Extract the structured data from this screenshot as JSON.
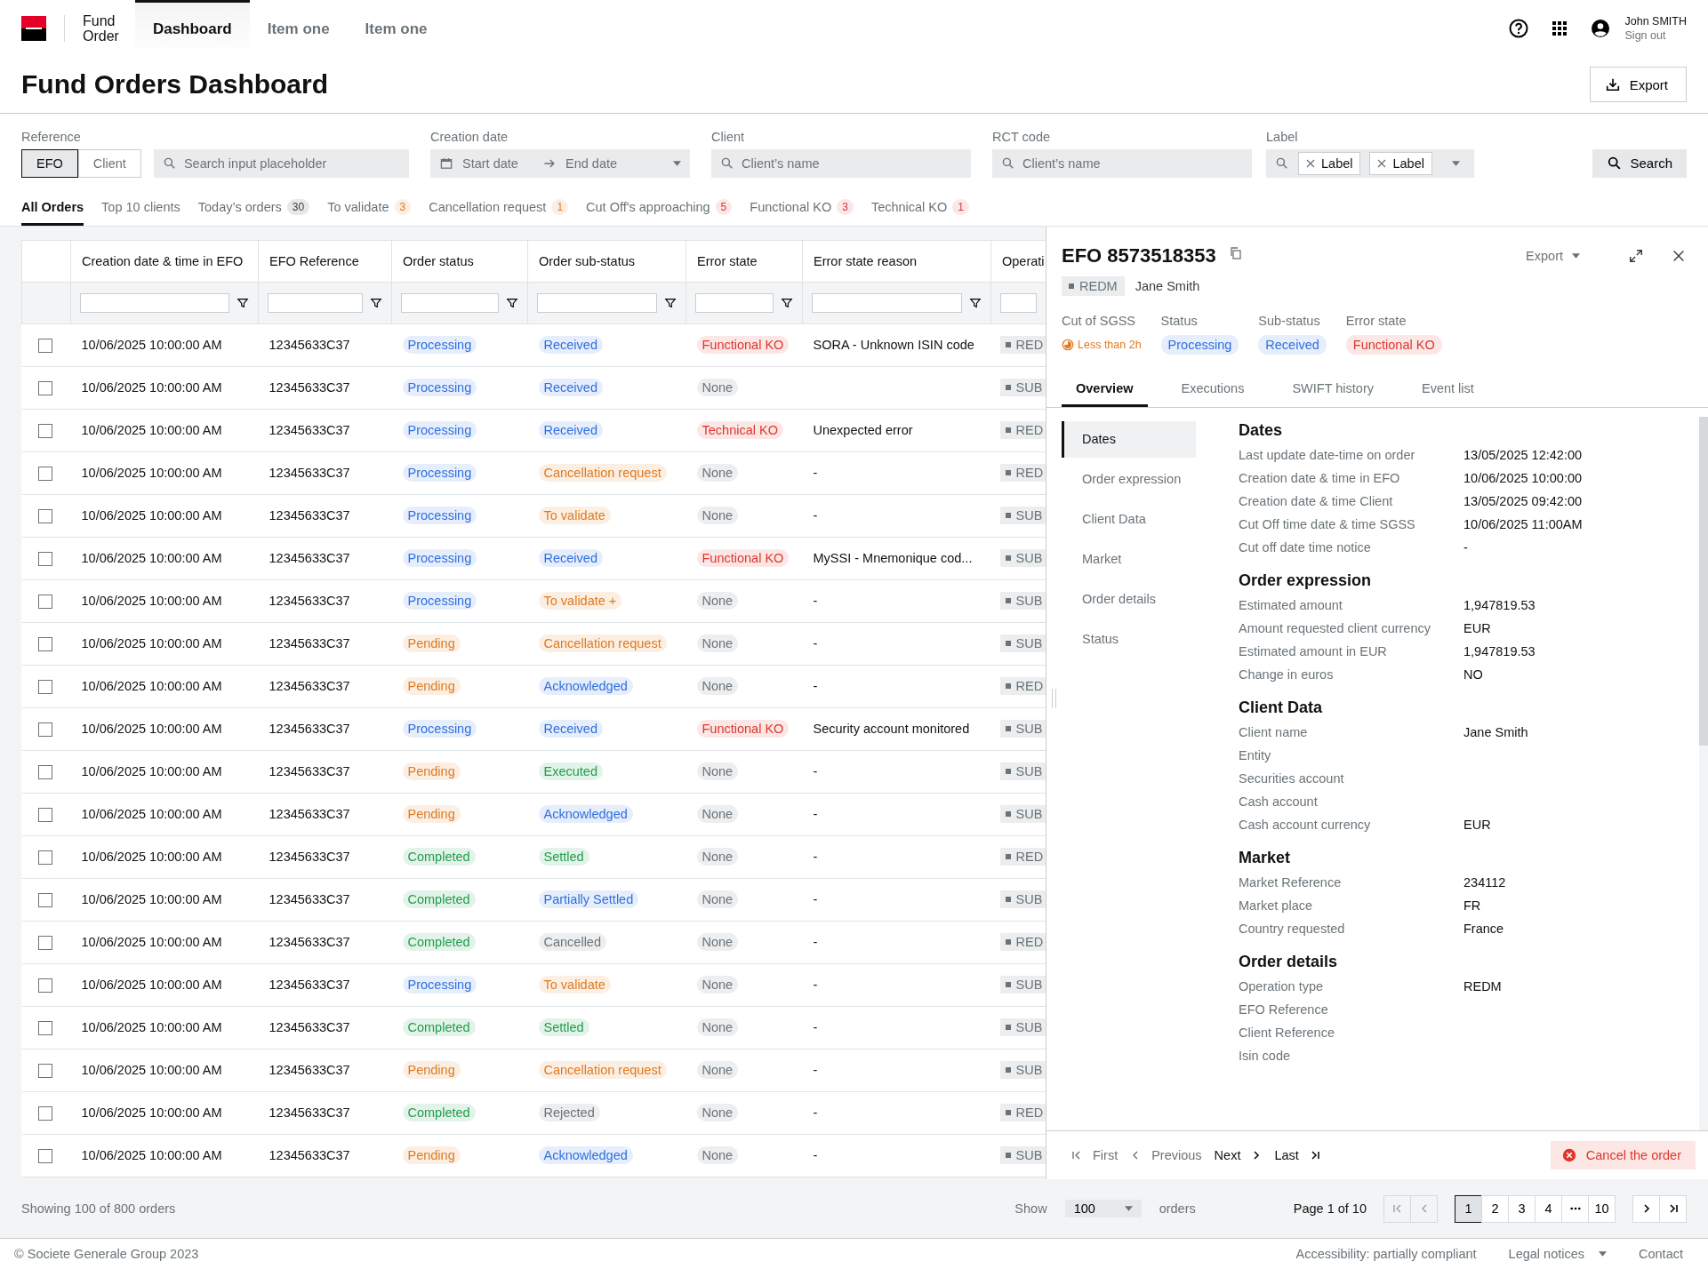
{
  "header": {
    "app_name_lines": [
      "Fund",
      "Order"
    ],
    "nav": [
      {
        "label": "Dashboard",
        "selected": true
      },
      {
        "label": "Item one",
        "selected": false
      },
      {
        "label": "Item one",
        "selected": false
      }
    ],
    "user": {
      "name": "John SMITH",
      "action": "Sign out"
    }
  },
  "page_title": "Fund Orders Dashboard",
  "export_button": "Export",
  "filters": {
    "reference": {
      "label": "Reference",
      "options": [
        {
          "label": "EFO",
          "selected": true
        },
        {
          "label": "Client",
          "selected": false
        }
      ],
      "placeholder": "Search input placeholder"
    },
    "creation_date": {
      "label": "Creation date",
      "start_placeholder": "Start date",
      "end_placeholder": "End date"
    },
    "client": {
      "label": "Client",
      "placeholder": "Client’s name"
    },
    "rct_code": {
      "label": "RCT code",
      "placeholder": "Client’s name"
    },
    "label": {
      "label": "Label",
      "tags": [
        "Label",
        "Label"
      ]
    },
    "search_button": "Search"
  },
  "order_tabs": [
    {
      "label": "All Orders",
      "selected": true
    },
    {
      "label": "Top 10 clients",
      "selected": false
    },
    {
      "label": "Today’s orders",
      "count": "30",
      "color": "#3a3f42",
      "selected": false
    },
    {
      "label": "To validate",
      "count": "3",
      "color": "#e07a1f",
      "selected": false
    },
    {
      "label": "Cancellation request",
      "count": "1",
      "color": "#e07a1f",
      "selected": false
    },
    {
      "label": "Cut Off's approaching",
      "count": "5",
      "color": "#e0352b",
      "selected": false
    },
    {
      "label": "Functional KO",
      "count": "3",
      "color": "#e0352b",
      "selected": false
    },
    {
      "label": "Technical KO",
      "count": "1",
      "color": "#e0352b",
      "selected": false
    }
  ],
  "table": {
    "columns": [
      "Creation date & time in EFO",
      "EFO Reference",
      "Order status",
      "Order sub-status",
      "Error state",
      "Error state reason",
      "Operati"
    ],
    "rows": [
      {
        "checked": false,
        "date": "10/06/2025 10:00:00 AM",
        "ref": "12345633C37",
        "status": {
          "text": "Processing",
          "color": "#2f6fe0"
        },
        "sub": {
          "text": "Received",
          "color": "#2f6fe0"
        },
        "error": {
          "text": "Functional KO",
          "color": "#e0352b"
        },
        "reason": "SORA - Unknown ISIN code",
        "op": "RED"
      },
      {
        "checked": false,
        "date": "10/06/2025 10:00:00 AM",
        "ref": "12345633C37",
        "status": {
          "text": "Processing",
          "color": "#2f6fe0"
        },
        "sub": {
          "text": "Received",
          "color": "#2f6fe0"
        },
        "error": {
          "text": "None",
          "color": "#6b7378"
        },
        "op": "SUB"
      },
      {
        "checked": false,
        "date": "10/06/2025 10:00:00 AM",
        "ref": "12345633C37",
        "status": {
          "text": "Processing",
          "color": "#2f6fe0"
        },
        "sub": {
          "text": "Received",
          "color": "#2f6fe0"
        },
        "error": {
          "text": "Technical KO",
          "color": "#e0352b"
        },
        "reason": "Unexpected error",
        "op": "RED"
      },
      {
        "checked": false,
        "date": "10/06/2025 10:00:00 AM",
        "ref": "12345633C37",
        "status": {
          "text": "Processing",
          "color": "#2f6fe0"
        },
        "sub": {
          "text": "Cancellation request",
          "color": "#e07a1f"
        },
        "error": {
          "text": "None",
          "color": "#6b7378"
        },
        "reason": "-",
        "op": "RED"
      },
      {
        "checked": false,
        "date": "10/06/2025 10:00:00 AM",
        "ref": "12345633C37",
        "status": {
          "text": "Processing",
          "color": "#2f6fe0"
        },
        "sub": {
          "text": "To validate",
          "color": "#e07a1f"
        },
        "error": {
          "text": "None",
          "color": "#6b7378"
        },
        "reason": "-",
        "op": "SUB"
      },
      {
        "checked": false,
        "date": "10/06/2025 10:00:00 AM",
        "ref": "12345633C37",
        "status": {
          "text": "Processing",
          "color": "#2f6fe0"
        },
        "sub": {
          "text": "Received",
          "color": "#2f6fe0"
        },
        "error": {
          "text": "Functional KO",
          "color": "#e0352b"
        },
        "reason": "MySSI - Mnemonique cod...",
        "op": "SUB"
      },
      {
        "checked": false,
        "date": "10/06/2025 10:00:00 AM",
        "ref": "12345633C37",
        "status": {
          "text": "Processing",
          "color": "#2f6fe0"
        },
        "sub": {
          "text": "To validate +",
          "color": "#e07a1f"
        },
        "error": {
          "text": "None",
          "color": "#6b7378"
        },
        "reason": "-",
        "op": "SUB"
      },
      {
        "checked": false,
        "date": "10/06/2025 10:00:00 AM",
        "ref": "12345633C37",
        "status": {
          "text": "Pending",
          "color": "#e07a1f"
        },
        "sub": {
          "text": "Cancellation request",
          "color": "#e07a1f"
        },
        "error": {
          "text": "None",
          "color": "#6b7378"
        },
        "reason": "-",
        "op": "SUB"
      },
      {
        "checked": false,
        "date": "10/06/2025 10:00:00 AM",
        "ref": "12345633C37",
        "status": {
          "text": "Pending",
          "color": "#e07a1f"
        },
        "sub": {
          "text": "Acknowledged",
          "color": "#2f6fe0"
        },
        "error": {
          "text": "None",
          "color": "#6b7378"
        },
        "reason": "-",
        "op": "RED"
      },
      {
        "checked": false,
        "date": "10/06/2025 10:00:00 AM",
        "ref": "12345633C37",
        "status": {
          "text": "Processing",
          "color": "#2f6fe0"
        },
        "sub": {
          "text": "Received",
          "color": "#2f6fe0"
        },
        "error": {
          "text": "Functional KO",
          "color": "#e0352b"
        },
        "reason": "Security account monitored",
        "op": "SUB"
      },
      {
        "checked": false,
        "date": "10/06/2025 10:00:00 AM",
        "ref": "12345633C37",
        "status": {
          "text": "Pending",
          "color": "#e07a1f"
        },
        "sub": {
          "text": "Executed",
          "color": "#1e9e4a"
        },
        "error": {
          "text": "None",
          "color": "#6b7378"
        },
        "reason": "-",
        "op": "SUB"
      },
      {
        "checked": false,
        "date": "10/06/2025 10:00:00 AM",
        "ref": "12345633C37",
        "status": {
          "text": "Pending",
          "color": "#e07a1f"
        },
        "sub": {
          "text": "Acknowledged",
          "color": "#2f6fe0"
        },
        "error": {
          "text": "None",
          "color": "#6b7378"
        },
        "reason": "-",
        "op": "SUB"
      },
      {
        "checked": false,
        "date": "10/06/2025 10:00:00 AM",
        "ref": "12345633C37",
        "status": {
          "text": "Completed",
          "color": "#1e9e4a"
        },
        "sub": {
          "text": "Settled",
          "color": "#1e9e4a"
        },
        "error": {
          "text": "None",
          "color": "#6b7378"
        },
        "reason": "-",
        "op": "RED"
      },
      {
        "checked": false,
        "date": "10/06/2025 10:00:00 AM",
        "ref": "12345633C37",
        "status": {
          "text": "Completed",
          "color": "#1e9e4a"
        },
        "sub": {
          "text": "Partially Settled",
          "color": "#2f6fe0"
        },
        "error": {
          "text": "None",
          "color": "#6b7378"
        },
        "reason": "-",
        "op": "SUB"
      },
      {
        "checked": false,
        "date": "10/06/2025 10:00:00 AM",
        "ref": "12345633C37",
        "status": {
          "text": "Completed",
          "color": "#1e9e4a"
        },
        "sub": {
          "text": "Cancelled",
          "color": "#6b7378"
        },
        "error": {
          "text": "None",
          "color": "#6b7378"
        },
        "reason": "-",
        "op": "RED"
      },
      {
        "checked": false,
        "date": "10/06/2025 10:00:00 AM",
        "ref": "12345633C37",
        "status": {
          "text": "Processing",
          "color": "#2f6fe0"
        },
        "sub": {
          "text": "To validate",
          "color": "#e07a1f"
        },
        "error": {
          "text": "None",
          "color": "#6b7378"
        },
        "reason": "-",
        "op": "SUB"
      },
      {
        "checked": false,
        "date": "10/06/2025 10:00:00 AM",
        "ref": "12345633C37",
        "status": {
          "text": "Completed",
          "color": "#1e9e4a"
        },
        "sub": {
          "text": "Settled",
          "color": "#1e9e4a"
        },
        "error": {
          "text": "None",
          "color": "#6b7378"
        },
        "reason": "-",
        "op": "SUB"
      },
      {
        "checked": false,
        "date": "10/06/2025 10:00:00 AM",
        "ref": "12345633C37",
        "status": {
          "text": "Pending",
          "color": "#e07a1f"
        },
        "sub": {
          "text": "Cancellation request",
          "color": "#e07a1f"
        },
        "error": {
          "text": "None",
          "color": "#6b7378"
        },
        "reason": "-",
        "op": "SUB"
      },
      {
        "checked": false,
        "date": "10/06/2025 10:00:00 AM",
        "ref": "12345633C37",
        "status": {
          "text": "Completed",
          "color": "#1e9e4a"
        },
        "sub": {
          "text": "Rejected",
          "color": "#6b7378"
        },
        "error": {
          "text": "None",
          "color": "#6b7378"
        },
        "reason": "-",
        "op": "RED"
      },
      {
        "checked": false,
        "date": "10/06/2025 10:00:00 AM",
        "ref": "12345633C37",
        "status": {
          "text": "Pending",
          "color": "#e07a1f"
        },
        "sub": {
          "text": "Acknowledged",
          "color": "#2f6fe0"
        },
        "error": {
          "text": "None",
          "color": "#6b7378"
        },
        "reason": "-",
        "op": "SUB"
      }
    ]
  },
  "detail": {
    "title": "EFO 8573518353",
    "export": "Export",
    "operation": "REDM",
    "client": "Jane Smith",
    "summary": [
      {
        "kind": "deadline",
        "label": "Cut of SGSS",
        "text": "Less than 2h"
      },
      {
        "kind": "chip",
        "label": "Status",
        "text": "Processing",
        "color": "#2f6fe0"
      },
      {
        "kind": "chip",
        "label": "Sub-status",
        "text": "Received",
        "color": "#2f6fe0"
      },
      {
        "kind": "chip",
        "label": "Error state",
        "text": "Functional KO",
        "color": "#e0352b"
      }
    ],
    "tabs": [
      {
        "label": "Overview",
        "selected": true
      },
      {
        "label": "Executions",
        "selected": false
      },
      {
        "label": "SWIFT history",
        "selected": false
      },
      {
        "label": "Event list",
        "selected": false
      }
    ],
    "side_nav": [
      {
        "label": "Dates",
        "selected": true
      },
      {
        "label": "Order expression",
        "selected": false
      },
      {
        "label": "Client Data",
        "selected": false
      },
      {
        "label": "Market",
        "selected": false
      },
      {
        "label": "Order details",
        "selected": false
      },
      {
        "label": "Status",
        "selected": false
      }
    ],
    "sections": [
      {
        "title": "Dates",
        "fields": [
          {
            "label": "Last update date-time on order",
            "value": "13/05/2025 12:42:00"
          },
          {
            "label": "Creation date & time in EFO",
            "value": "10/06/2025 10:00:00"
          },
          {
            "label": "Creation date & time Client",
            "value": "13/05/2025 09:42:00"
          },
          {
            "label": "Cut Off time date & time SGSS",
            "value": "10/06/2025 11:00AM"
          },
          {
            "label": "Cut off date time notice",
            "value": "-"
          }
        ]
      },
      {
        "title": "Order expression",
        "fields": [
          {
            "label": "Estimated amount",
            "value": "1,947819.53"
          },
          {
            "label": "Amount requested client currency",
            "value": "EUR"
          },
          {
            "label": "Estimated amount in EUR",
            "value": "1,947819.53"
          },
          {
            "label": "Change in euros",
            "value": "NO"
          }
        ]
      },
      {
        "title": "Client Data",
        "fields": [
          {
            "label": "Client name",
            "value": "Jane Smith"
          },
          {
            "label": "Entity"
          },
          {
            "label": "Securities account"
          },
          {
            "label": "Cash account"
          },
          {
            "label": "Cash account currency",
            "value": "EUR"
          }
        ]
      },
      {
        "title": "Market",
        "fields": [
          {
            "label": "Market Reference",
            "value": "234112"
          },
          {
            "label": "Market place",
            "value": "FR"
          },
          {
            "label": "Country requested",
            "value": "France"
          }
        ]
      },
      {
        "title": "Order details",
        "fields": [
          {
            "label": "Operation type",
            "value": "REDM"
          },
          {
            "label": "EFO Reference"
          },
          {
            "label": "Client Reference"
          },
          {
            "label": "Isin code"
          }
        ]
      }
    ],
    "pager": [
      {
        "kind": "first",
        "label": "First",
        "disabled": true
      },
      {
        "kind": "previous",
        "label": "Previous",
        "disabled": true
      },
      {
        "kind": "next",
        "label": "Next",
        "disabled": false
      },
      {
        "kind": "last",
        "label": "Last",
        "disabled": false
      }
    ],
    "cancel_button": "Cancel the order"
  },
  "bottom_bar": {
    "showing": "Showing 100 of 800 orders",
    "show_label": "Show",
    "page_size": "100",
    "orders_label": "orders",
    "page_info": "Page 1 of 10",
    "pages": [
      {
        "kind": "page",
        "label": "1",
        "selected": true
      },
      {
        "kind": "page",
        "label": "2",
        "selected": false
      },
      {
        "kind": "page",
        "label": "3",
        "selected": false
      },
      {
        "kind": "page",
        "label": "4",
        "selected": false
      },
      {
        "kind": "ellipsis",
        "selected": false
      },
      {
        "kind": "page",
        "label": "10",
        "selected": false
      }
    ]
  },
  "page_footer": {
    "copyright": "© Societe Generale Group 2023",
    "links": [
      {
        "label": "Accessibility: partially compliant",
        "dropdown": false
      },
      {
        "label": "Legal notices",
        "dropdown": true
      },
      {
        "label": "Contact",
        "dropdown": false
      }
    ]
  }
}
